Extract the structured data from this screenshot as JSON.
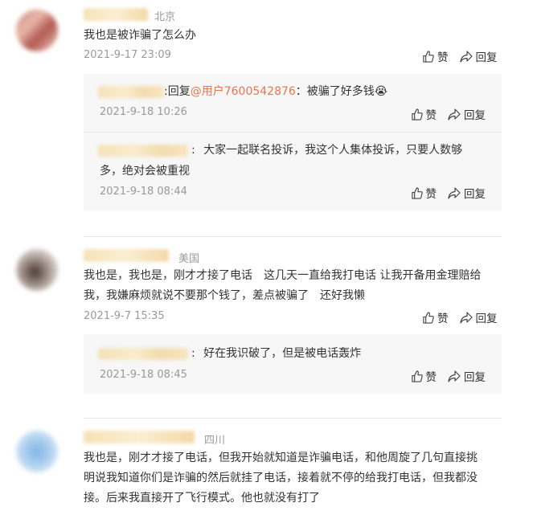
{
  "comments": [
    {
      "location": "北京",
      "text": "我也是被诈骗了怎么办",
      "date": "2021-9-17 23:09",
      "like": "赞",
      "reply": "回复",
      "replies": [
        {
          "prefix": ":",
          "reply_word": "回复",
          "mention": "@用户7600542876",
          "text": "：被骗了好多钱",
          "emoji": "😭",
          "date": "2021-9-18 10:26",
          "like": "赞",
          "reply": "回复"
        },
        {
          "prefix": ":",
          "text": "大家一起联名投诉，我这个人集体投诉，只要人数够多，绝对会被重视",
          "line1": "大家一起联名投诉，我这个人集体投诉，只要人数够",
          "line2": "多，绝对会被重视",
          "date": "2021-9-18 08:44",
          "like": "赞",
          "reply": "回复"
        }
      ]
    },
    {
      "location": "美国",
      "line1": "我也是，我也是，刚才才接了电话　这几天一直给我打电话  让我开备用金理赔给",
      "line2": "我，我嫌麻烦就说不要那个钱了，差点被骗了　还好我懒",
      "date": "2021-9-7 15:35",
      "like": "赞",
      "reply": "回复",
      "replies": [
        {
          "prefix": ":",
          "text": "好在我识破了，但是被电话轰炸",
          "date": "2021-9-18 08:45",
          "like": "赞",
          "reply": "回复"
        }
      ]
    },
    {
      "location": "四川",
      "line1": "我也是，刚才才接了电话，但我开始就知道是诈骗电话，和他周旋了几句直接挑",
      "line2": "明说我知道你们是诈骗的然后就挂了电话，接着就不停的给我打电话，但我都没",
      "line3": "接。后来我直接开了飞行模式。他也就没有打了"
    }
  ],
  "colors": {
    "mention": "#eb7350",
    "meta": "#999999",
    "reply_bg": "#f7f7f7"
  },
  "icons": [
    "thumbs-up-icon",
    "share-arrow-icon"
  ]
}
